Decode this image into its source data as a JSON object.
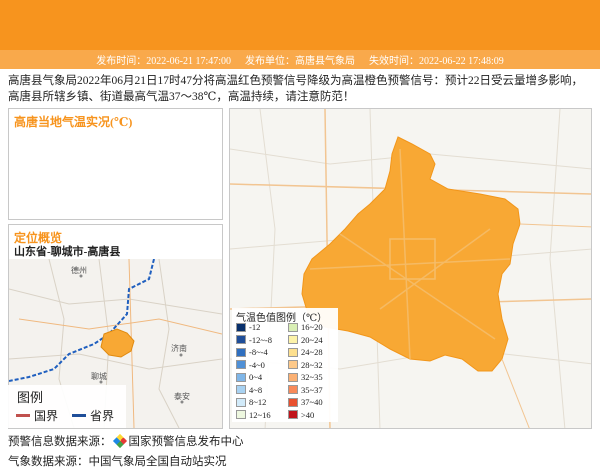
{
  "header": {
    "publish_time": "发布时间：2022-06-21 17:47:00",
    "publisher": "发布单位：高唐县气象局",
    "expire_time": "失效时间：2022-06-22 17:48:09"
  },
  "notice": "高唐县气象局2022年06月21日17时47分将高温红色预警信号降级为高温橙色预警信号：预计22日受云量增多影响，高唐县所辖乡镇、街道最高气温37～38℃，高温持续，请注意防范！",
  "temp_panel": {
    "title": "高唐当地气温实况(℃)"
  },
  "location_panel": {
    "title": "定位概览",
    "location": "山东省-聊城市-高唐县",
    "map_labels": [
      "德州",
      "聊城",
      "济南",
      "泰安"
    ]
  },
  "map_legend": {
    "title": "图例",
    "items": [
      {
        "label": "国界",
        "color": "#c0504d"
      },
      {
        "label": "省界",
        "color": "#1f4e99"
      }
    ]
  },
  "temp_color_legend": {
    "title": "气温色值图例（℃）",
    "items": [
      {
        "label": "-12",
        "color": "#08306b"
      },
      {
        "label": "-12~-8",
        "color": "#1f4e99"
      },
      {
        "label": "-8~-4",
        "color": "#2f6fbf"
      },
      {
        "label": "-4~0",
        "color": "#4f90d6"
      },
      {
        "label": "0~4",
        "color": "#7fb6e8"
      },
      {
        "label": "4~8",
        "color": "#a8d2f2"
      },
      {
        "label": "8~12",
        "color": "#d2ebfa"
      },
      {
        "label": "12~16",
        "color": "#eef8e0"
      },
      {
        "label": "16~20",
        "color": "#d9efb5"
      },
      {
        "label": "20~24",
        "color": "#fdf3a9"
      },
      {
        "label": "24~28",
        "color": "#fde08f"
      },
      {
        "label": "28~32",
        "color": "#fdc98a"
      },
      {
        "label": "32~35",
        "color": "#fbb073"
      },
      {
        "label": "35~37",
        "color": "#f88a5a"
      },
      {
        "label": "37~40",
        "color": "#e8502f"
      },
      {
        "label": ">40",
        "color": "#c0141b"
      }
    ]
  },
  "footer": {
    "warning_source": "预警信息数据来源：",
    "warning_source_name": "国家预警信息发布中心",
    "weather_source": "气象数据来源：中国气象局全国自动站实况"
  },
  "colors": {
    "accent": "#f7941e",
    "region_fill": "#f8a834"
  }
}
